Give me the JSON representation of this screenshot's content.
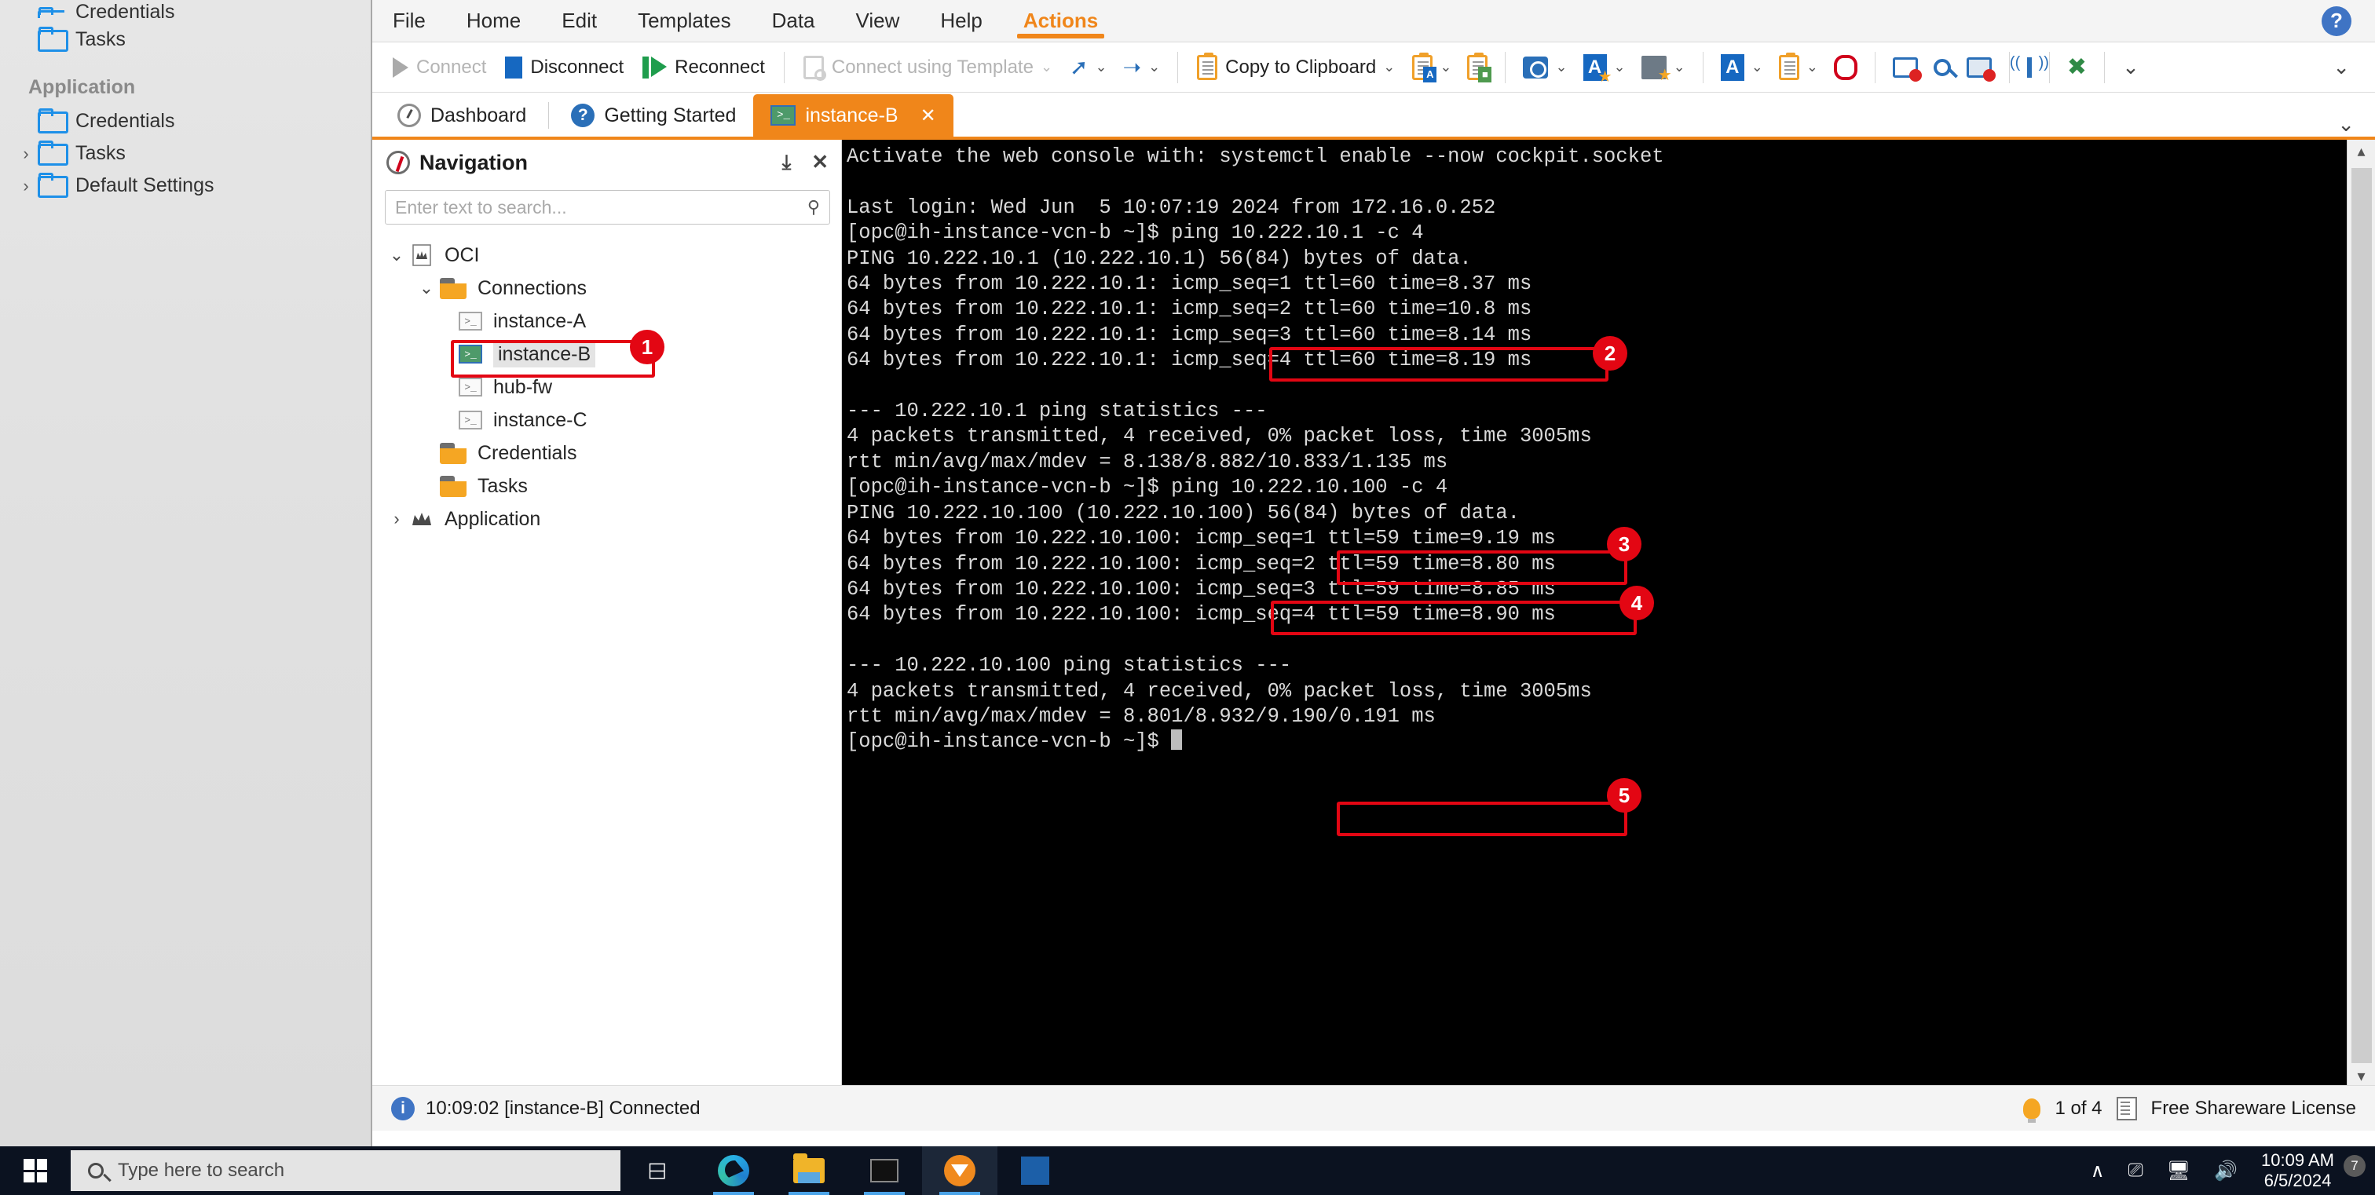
{
  "left_sidebar": {
    "top_items": [
      {
        "label": "Credentials",
        "icon": "folder-icon",
        "expandable": false,
        "clipped": true
      },
      {
        "label": "Tasks",
        "icon": "folder-icon",
        "expandable": false
      }
    ],
    "section_label": "Application",
    "app_items": [
      {
        "label": "Credentials",
        "icon": "folder-icon",
        "expandable": false
      },
      {
        "label": "Tasks",
        "icon": "folder-icon",
        "expandable": true
      },
      {
        "label": "Default Settings",
        "icon": "folder-icon",
        "expandable": true
      }
    ],
    "bottom_bar": {
      "add_label": "+",
      "gear_label": "gear-icon",
      "transfer_label": "transfer-icon",
      "star_label": "star-icon",
      "play_label": "play-icon"
    }
  },
  "menubar": {
    "items": [
      "File",
      "Home",
      "Edit",
      "Templates",
      "Data",
      "View",
      "Help",
      "Actions"
    ],
    "active": "Actions",
    "help_icon": "?"
  },
  "toolbar": {
    "connect": "Connect",
    "disconnect": "Disconnect",
    "reconnect": "Reconnect",
    "connect_using_template": "Connect using Template",
    "copy_to_clipboard": "Copy to Clipboard",
    "caret": "⌄",
    "overflow_caret": "⌄"
  },
  "tabs": {
    "items": [
      {
        "label": "Dashboard",
        "icon": "dashboard-icon",
        "active": false,
        "closable": false
      },
      {
        "label": "Getting Started",
        "icon": "question-icon",
        "active": false,
        "closable": false
      },
      {
        "label": "instance-B",
        "icon": "terminal-icon",
        "active": true,
        "closable": true
      }
    ],
    "close_glyph": "✕",
    "overflow_glyph": "⌄"
  },
  "navigation": {
    "title": "Navigation",
    "pin_glyph": "⤓",
    "close_glyph": "✕",
    "search_placeholder": "Enter text to search...",
    "search_value": "",
    "search_icon": "search-icon",
    "tree": [
      {
        "label": "OCI",
        "icon": "crown-doc-icon",
        "indent": 0,
        "twisty": "⌄"
      },
      {
        "label": "Connections",
        "icon": "folder-orange-icon",
        "indent": 1,
        "twisty": "⌄"
      },
      {
        "label": "instance-A",
        "icon": "terminal-small-icon",
        "indent": 2,
        "twisty": ""
      },
      {
        "label": "instance-B",
        "icon": "terminal-small-selected-icon",
        "indent": 2,
        "twisty": "",
        "selected": true,
        "annotation": "1"
      },
      {
        "label": "hub-fw",
        "icon": "terminal-small-icon",
        "indent": 2,
        "twisty": ""
      },
      {
        "label": "instance-C",
        "icon": "terminal-small-icon",
        "indent": 2,
        "twisty": ""
      },
      {
        "label": "Credentials",
        "icon": "folder-orange-icon",
        "indent": 1,
        "twisty": ""
      },
      {
        "label": "Tasks",
        "icon": "folder-orange-icon",
        "indent": 1,
        "twisty": ""
      },
      {
        "label": "Application",
        "icon": "crown-icon",
        "indent": 0,
        "twisty": "›"
      }
    ]
  },
  "terminal": {
    "lines": [
      "Activate the web console with: systemctl enable --now cockpit.socket",
      "",
      "Last login: Wed Jun  5 10:07:19 2024 from 172.16.0.252",
      "[opc@ih-instance-vcn-b ~]$ ping 10.222.10.1 -c 4",
      "PING 10.222.10.1 (10.222.10.1) 56(84) bytes of data.",
      "64 bytes from 10.222.10.1: icmp_seq=1 ttl=60 time=8.37 ms",
      "64 bytes from 10.222.10.1: icmp_seq=2 ttl=60 time=10.8 ms",
      "64 bytes from 10.222.10.1: icmp_seq=3 ttl=60 time=8.14 ms",
      "64 bytes from 10.222.10.1: icmp_seq=4 ttl=60 time=8.19 ms",
      "",
      "--- 10.222.10.1 ping statistics ---",
      "4 packets transmitted, 4 received, 0% packet loss, time 3005ms",
      "rtt min/avg/max/mdev = 8.138/8.882/10.833/1.135 ms",
      "[opc@ih-instance-vcn-b ~]$ ping 10.222.10.100 -c 4",
      "PING 10.222.10.100 (10.222.10.100) 56(84) bytes of data.",
      "64 bytes from 10.222.10.100: icmp_seq=1 ttl=59 time=9.19 ms",
      "64 bytes from 10.222.10.100: icmp_seq=2 ttl=59 time=8.80 ms",
      "64 bytes from 10.222.10.100: icmp_seq=3 ttl=59 time=8.85 ms",
      "64 bytes from 10.222.10.100: icmp_seq=4 ttl=59 time=8.90 ms",
      "",
      "--- 10.222.10.100 ping statistics ---",
      "4 packets transmitted, 4 received, 0% packet loss, time 3005ms",
      "rtt min/avg/max/mdev = 8.801/8.932/9.190/0.191 ms",
      "[opc@ih-instance-vcn-b ~]$ "
    ],
    "prompt_cursor": true
  },
  "annotations": [
    {
      "number": "1",
      "target": "nav-instance-b"
    },
    {
      "number": "2",
      "target": "ping 10.222.10.1 -c 4"
    },
    {
      "number": "3",
      "target": "0% packet loss,"
    },
    {
      "number": "4",
      "target": "ping 10.222.10.100 -c 4"
    },
    {
      "number": "5",
      "target": "0% packet loss,"
    }
  ],
  "statusbar": {
    "message": "10:09:02 [instance-B] Connected",
    "tip_counter": "1 of 4",
    "license": "Free Shareware License"
  },
  "taskbar": {
    "search_placeholder": "Type here to search",
    "time": "10:09 AM",
    "date": "6/5/2024",
    "notification_count": "7",
    "apps": [
      "task-view-icon",
      "edge-icon",
      "file-explorer-icon",
      "command-prompt-icon",
      "mremoteng-icon",
      "putty-icon"
    ]
  },
  "colors": {
    "accent_orange": "#f0861a",
    "annotation_red": "#e30613",
    "blue": "#2a6fb8",
    "folder_orange": "#f5a623"
  }
}
